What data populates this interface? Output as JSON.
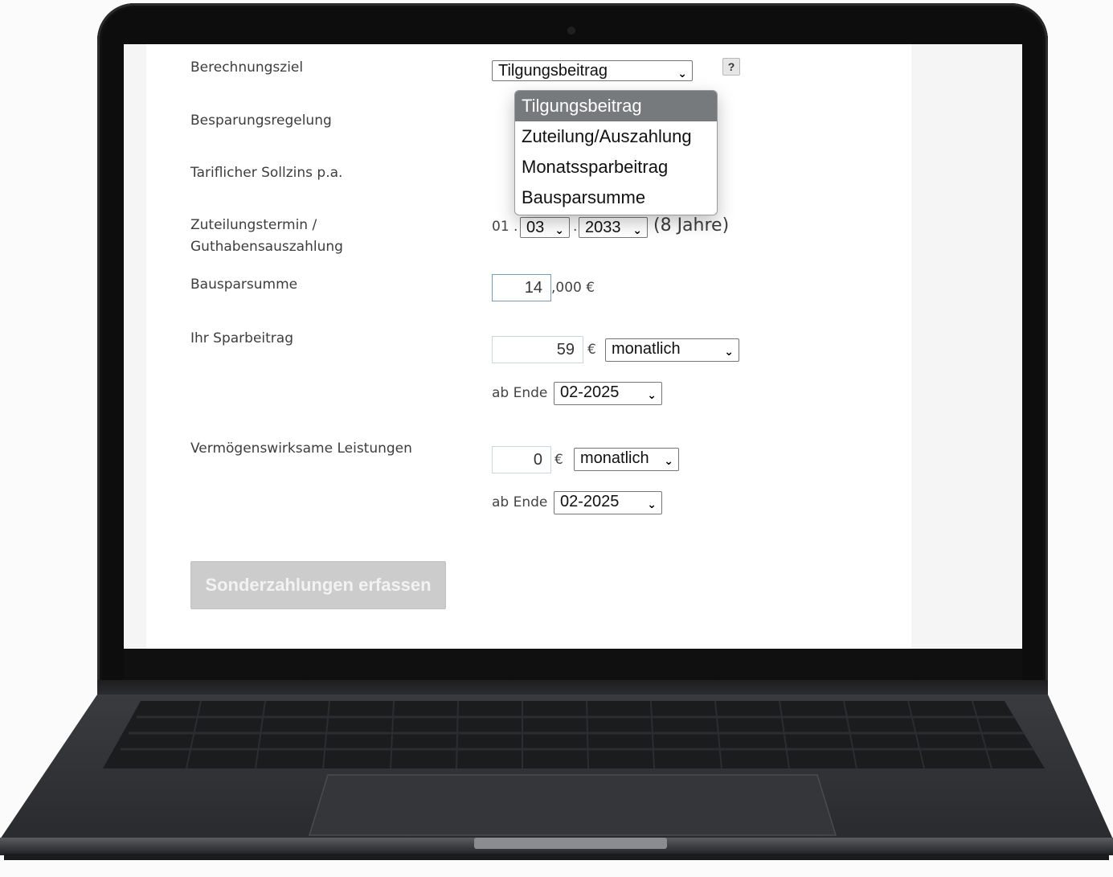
{
  "form": {
    "berechnungsziel": {
      "label": "Berechnungsziel",
      "selected": "Tilgungsbeitrag",
      "help": "?",
      "options": [
        "Tilgungsbeitrag",
        "Zuteilung/Auszahlung",
        "Monatssparbeitrag",
        "Bausparsumme"
      ]
    },
    "besparungsregelung": {
      "label": "Besparungsregelung"
    },
    "sollzins": {
      "label": "Tariflicher Sollzins p.a."
    },
    "zuteilungstermin": {
      "label_line1": "Zuteilungstermin /",
      "label_line2": "Guthabensauszahlung",
      "day_prefix": "01 .",
      "month": "03",
      "separator": ".",
      "year": "2033",
      "duration": "(8 Jahre)"
    },
    "bausparsumme": {
      "label": "Bausparsumme",
      "value": "14",
      "suffix": ",000 €"
    },
    "sparbeitrag": {
      "label": "Ihr Sparbeitrag",
      "value": "59",
      "currency": "€",
      "interval": "monatlich",
      "ab_ende_label": "ab Ende",
      "ab_ende_value": "02-2025"
    },
    "vl": {
      "label": "Vermögenswirksame Leistungen",
      "value": "0",
      "currency": "€",
      "interval": "monatlich",
      "ab_ende_label": "ab Ende",
      "ab_ende_value": "02-2025"
    },
    "sonderzahlungen_button": "Sonderzahlungen erfassen"
  },
  "colors": {
    "dropdown_selected_bg": "#777a7c",
    "button_disabled_bg": "#cccccc",
    "input_border": "#c9d7e4",
    "laptop_body": "#2d2e31"
  }
}
